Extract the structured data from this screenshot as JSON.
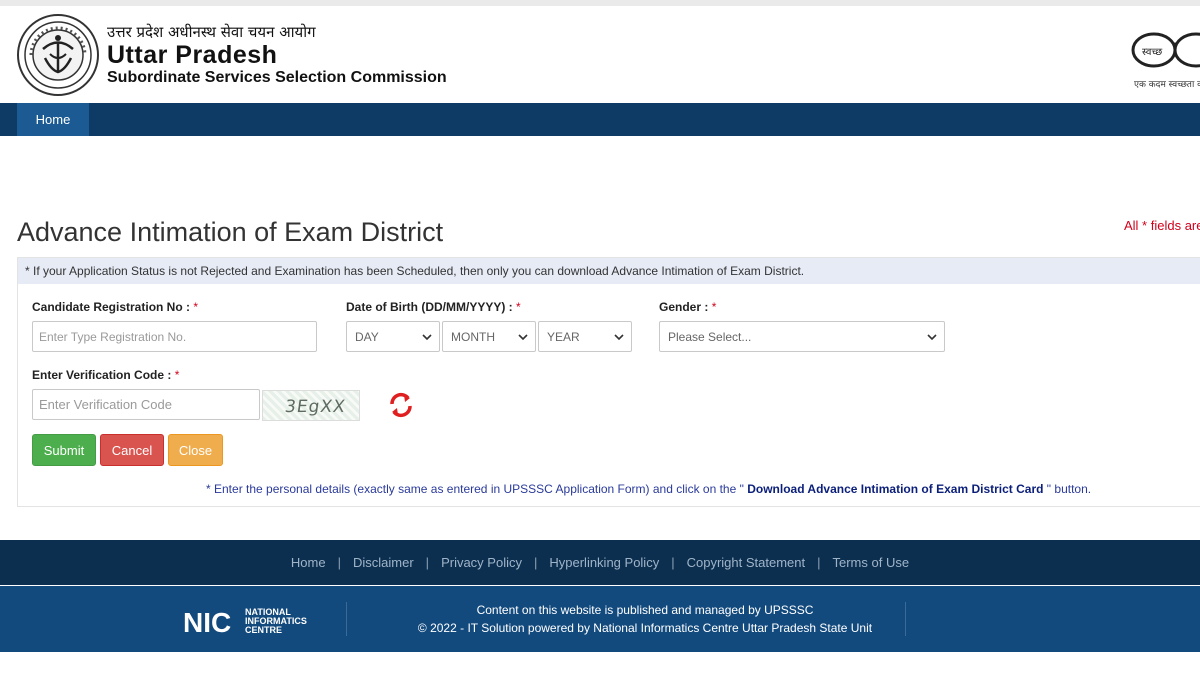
{
  "header": {
    "hindi_title": "उत्तर प्रदेश अधीनस्थ सेवा चयन आयोग",
    "title": "Uttar Pradesh",
    "subtitle": "Subordinate Services Selection Commission",
    "right_logo_text": "एक कदम स्वच्छता की ओर",
    "right_logo_word": "स्वच्छ"
  },
  "nav": {
    "home": "Home"
  },
  "page": {
    "title": "Advance Intimation of Exam District",
    "required_note": "All * fields are"
  },
  "form": {
    "notice": "* If your Application Status is not Rejected and Examination has been Scheduled, then only you can download Advance Intimation of Exam District.",
    "registration_label": "Candidate Registration No :",
    "registration_placeholder": "Enter Type Registration No.",
    "dob_label": "Date of Birth (DD/MM/YYYY) :",
    "dob_day": "DAY",
    "dob_month": "MONTH",
    "dob_year": "YEAR",
    "gender_label": "Gender :",
    "gender_value": "Please Select...",
    "verification_label": "Enter Verification Code :",
    "verification_placeholder": "Enter Verification Code",
    "captcha_text": "3EgXX",
    "star": "*",
    "submit": "Submit",
    "cancel": "Cancel",
    "close": "Close",
    "instruction_pre": "* Enter the personal details (exactly same as entered in UPSSSC Application Form) and click on the \"",
    "instruction_bold": " Download Advance Intimation of Exam District Card ",
    "instruction_post": "\" button."
  },
  "footer": {
    "links": [
      "Home",
      "Disclaimer",
      "Privacy Policy",
      "Hyperlinking Policy",
      "Copyright Statement",
      "Terms of Use"
    ],
    "separator": "|",
    "line1": "Content on this website is published and managed by UPSSSC",
    "line2": "© 2022 - IT Solution powered by National Informatics Centre Uttar Pradesh State Unit",
    "nic_big": "NIC",
    "nic_lines": [
      "NATIONAL",
      "INFORMATICS",
      "CENTRE"
    ]
  },
  "colors": {
    "navbar": "#0e3a66",
    "nav_active": "#1b5a93",
    "submit": "#4cae4c",
    "cancel": "#d9534f",
    "close": "#f0ad4e",
    "footer_top": "#0d2f4f",
    "footer_bottom": "#134a7e",
    "required": "#d0021b"
  },
  "icons": [
    "upsssc-emblem-logo",
    "swachh-bharat-glasses-logo",
    "chevron-down-icon",
    "refresh-icon",
    "nic-logo"
  ]
}
